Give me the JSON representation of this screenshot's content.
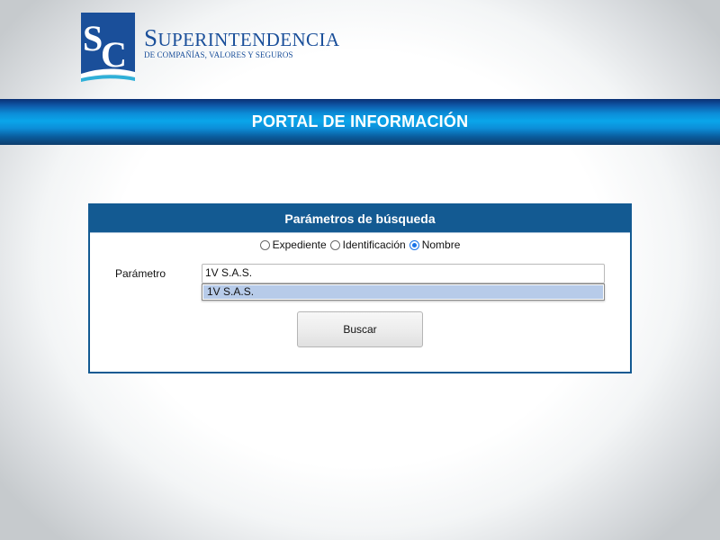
{
  "header": {
    "logo_monogram": "SC",
    "org_title_rest": "UPERINTENDENCIA",
    "org_title_cap": "S",
    "org_subtitle": "DE COMPAÑÍAS, VALORES Y SEGUROS"
  },
  "banner": {
    "title": "PORTAL DE INFORMACIÓN"
  },
  "search_panel": {
    "title": "Parámetros de búsqueda",
    "radio_options": [
      {
        "label": "Expediente",
        "checked": false
      },
      {
        "label": "Identificación",
        "checked": false
      },
      {
        "label": "Nombre",
        "checked": true
      }
    ],
    "param_label": "Parámetro",
    "param_value": "1V S.A.S.",
    "suggestions": [
      "1V S.A.S."
    ],
    "search_button_label": "Buscar"
  },
  "colors": {
    "brand_blue": "#1a4f9a",
    "panel_blue": "#135a92",
    "banner_cyan": "#0aa6ea",
    "suggestion_highlight": "#b7cbe9",
    "radio_checked": "#1a73e8"
  }
}
